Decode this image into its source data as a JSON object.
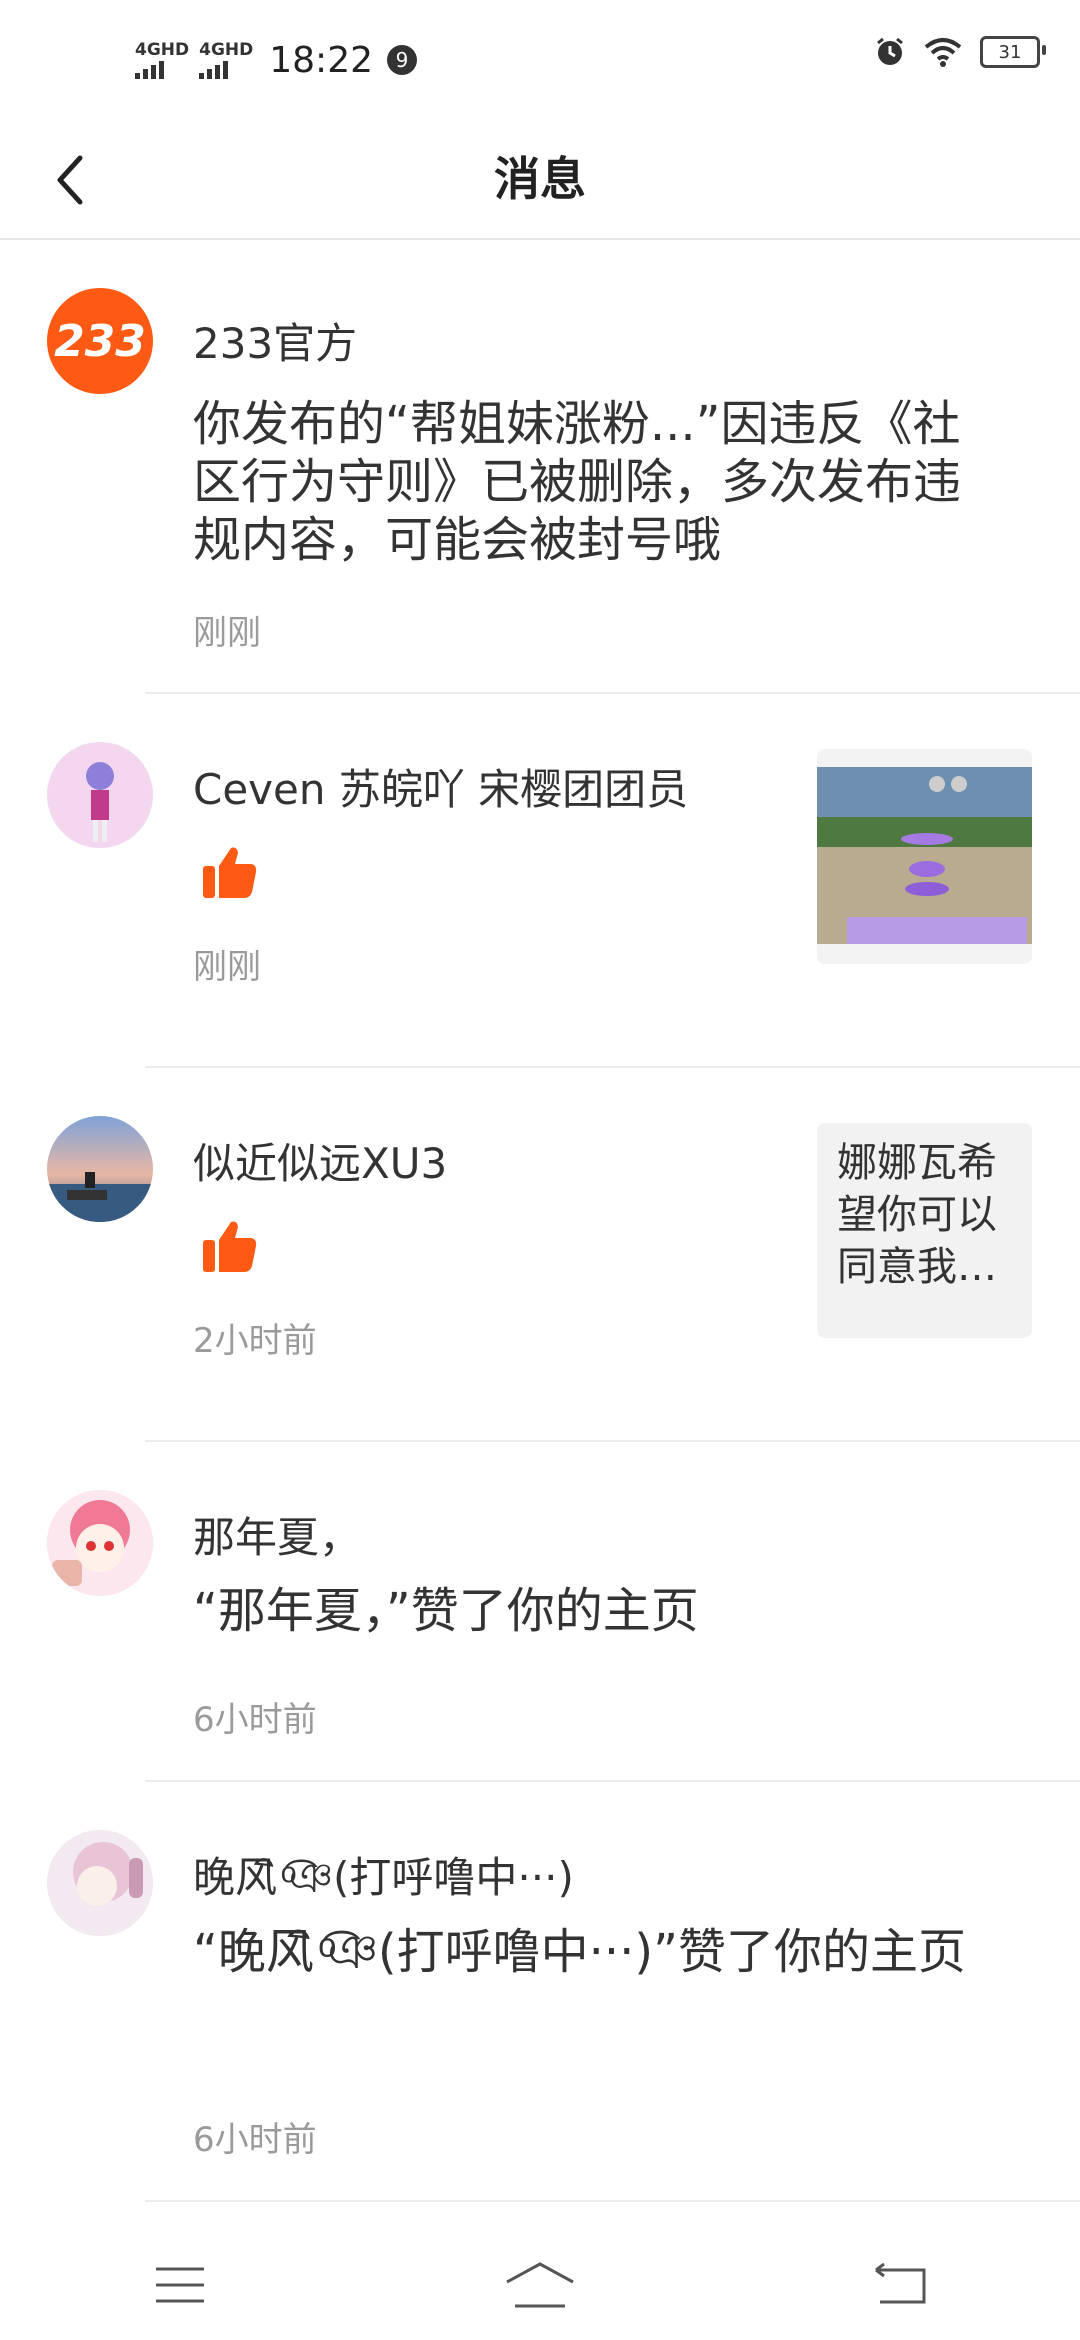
{
  "status_bar": {
    "signal1": "4GHD",
    "signal2": "4GHD",
    "time": "18:22",
    "notification_count": "9",
    "battery": "31"
  },
  "header": {
    "title": "消息"
  },
  "messages": [
    {
      "name": "233官方",
      "avatar_text": "233",
      "content": "你发布的“帮姐妹涨粉...”因违反《社区行为守则》已被删除，多次发布违规内容，可能会被封号哦",
      "time": "刚刚"
    },
    {
      "name": "Ceven  苏皖吖 宋樱团团员",
      "time": "刚刚",
      "icon": "thumbs-up-icon"
    },
    {
      "name": "似近似远XU3",
      "time": "2小时前",
      "icon": "thumbs-up-icon",
      "side_text": "娜娜瓦希望你可以同意我…"
    },
    {
      "name": "那年夏，",
      "content": "“那年夏，”赞了你的主页",
      "time": "6小时前"
    },
    {
      "name": "晚风ิ ͦ͡ঞ(打呼噜中···)",
      "content": "“晚风ิ ͦ͡ঞ(打呼噜中···)”赞了你的主页",
      "time": "6小时前"
    }
  ],
  "colors": {
    "accent": "#ff5a14",
    "divider": "#ececec"
  }
}
